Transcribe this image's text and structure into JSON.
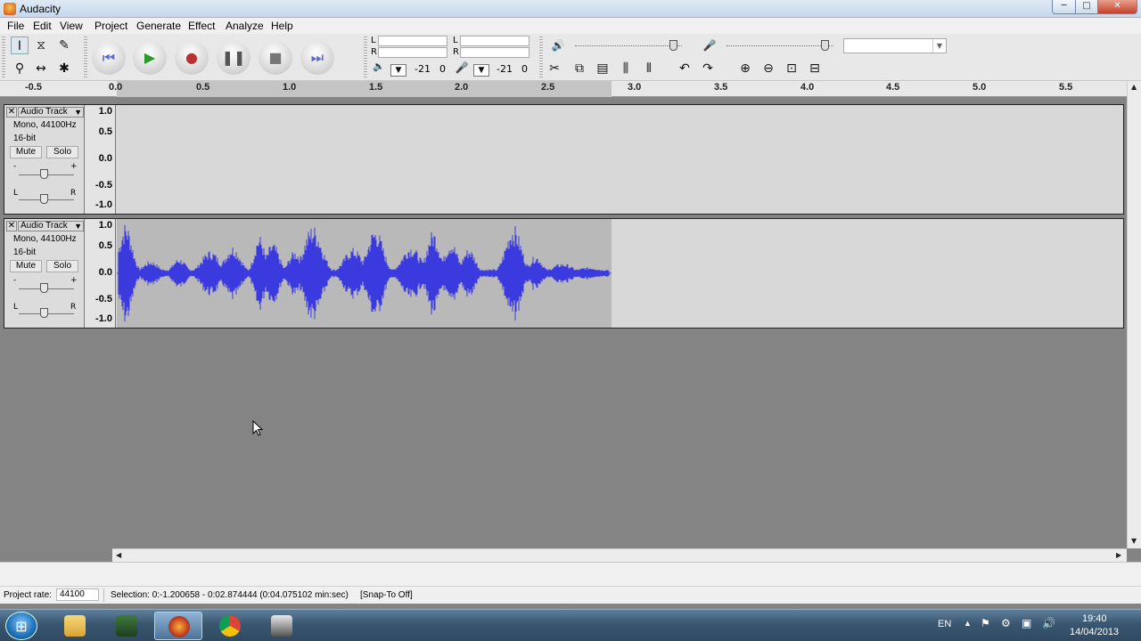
{
  "window": {
    "title": "Audacity",
    "minimize": "─",
    "maximize": "□",
    "close": "✕"
  },
  "menu": [
    "File",
    "Edit",
    "View",
    "Project",
    "Generate",
    "Effect",
    "Analyze",
    "Help"
  ],
  "meters": {
    "play_l": "L",
    "play_r": "R",
    "rec_l": "L",
    "rec_r": "R",
    "play_scale": [
      "-21",
      "0"
    ],
    "rec_scale": [
      "-21",
      "0"
    ]
  },
  "ruler": {
    "ticks": [
      "-0.5",
      "0.0",
      "0.5",
      "1.0",
      "1.5",
      "2.0",
      "2.5",
      "3.0",
      "3.5",
      "4.0",
      "4.5",
      "5.0",
      "5.5"
    ]
  },
  "tracks": [
    {
      "name": "Audio Track",
      "info1": "Mono, 44100Hz",
      "info2": "16-bit",
      "mute": "Mute",
      "solo": "Solo",
      "gain_minus": "-",
      "gain_plus": "+",
      "pan_l": "L",
      "pan_r": "R",
      "vticks": [
        "1.0",
        "0.5",
        "0.0",
        "-0.5",
        "-1.0"
      ]
    },
    {
      "name": "Audio Track",
      "info1": "Mono, 44100Hz",
      "info2": "16-bit",
      "mute": "Mute",
      "solo": "Solo",
      "gain_minus": "-",
      "gain_plus": "+",
      "pan_l": "L",
      "pan_r": "R",
      "vticks": [
        "1.0",
        "0.5",
        "0.0",
        "-0.5",
        "-1.0"
      ]
    }
  ],
  "status": {
    "rate_label": "Project rate:",
    "rate_value": "44100",
    "selection": "Selection: 0:-1.200658 - 0:02.874444 (0:04.075102 min:sec)",
    "snap": "[Snap-To Off]"
  },
  "taskbar": {
    "lang": "EN",
    "time": "19:40",
    "date": "14/04/2013",
    "apps": [
      "windows-explorer",
      "bf-game",
      "audacity",
      "chrome",
      "hypercam"
    ]
  },
  "colors": {
    "waveform": "#3a3adf",
    "selection": "#b9b9b9",
    "track_bg": "#d8d8d8"
  }
}
